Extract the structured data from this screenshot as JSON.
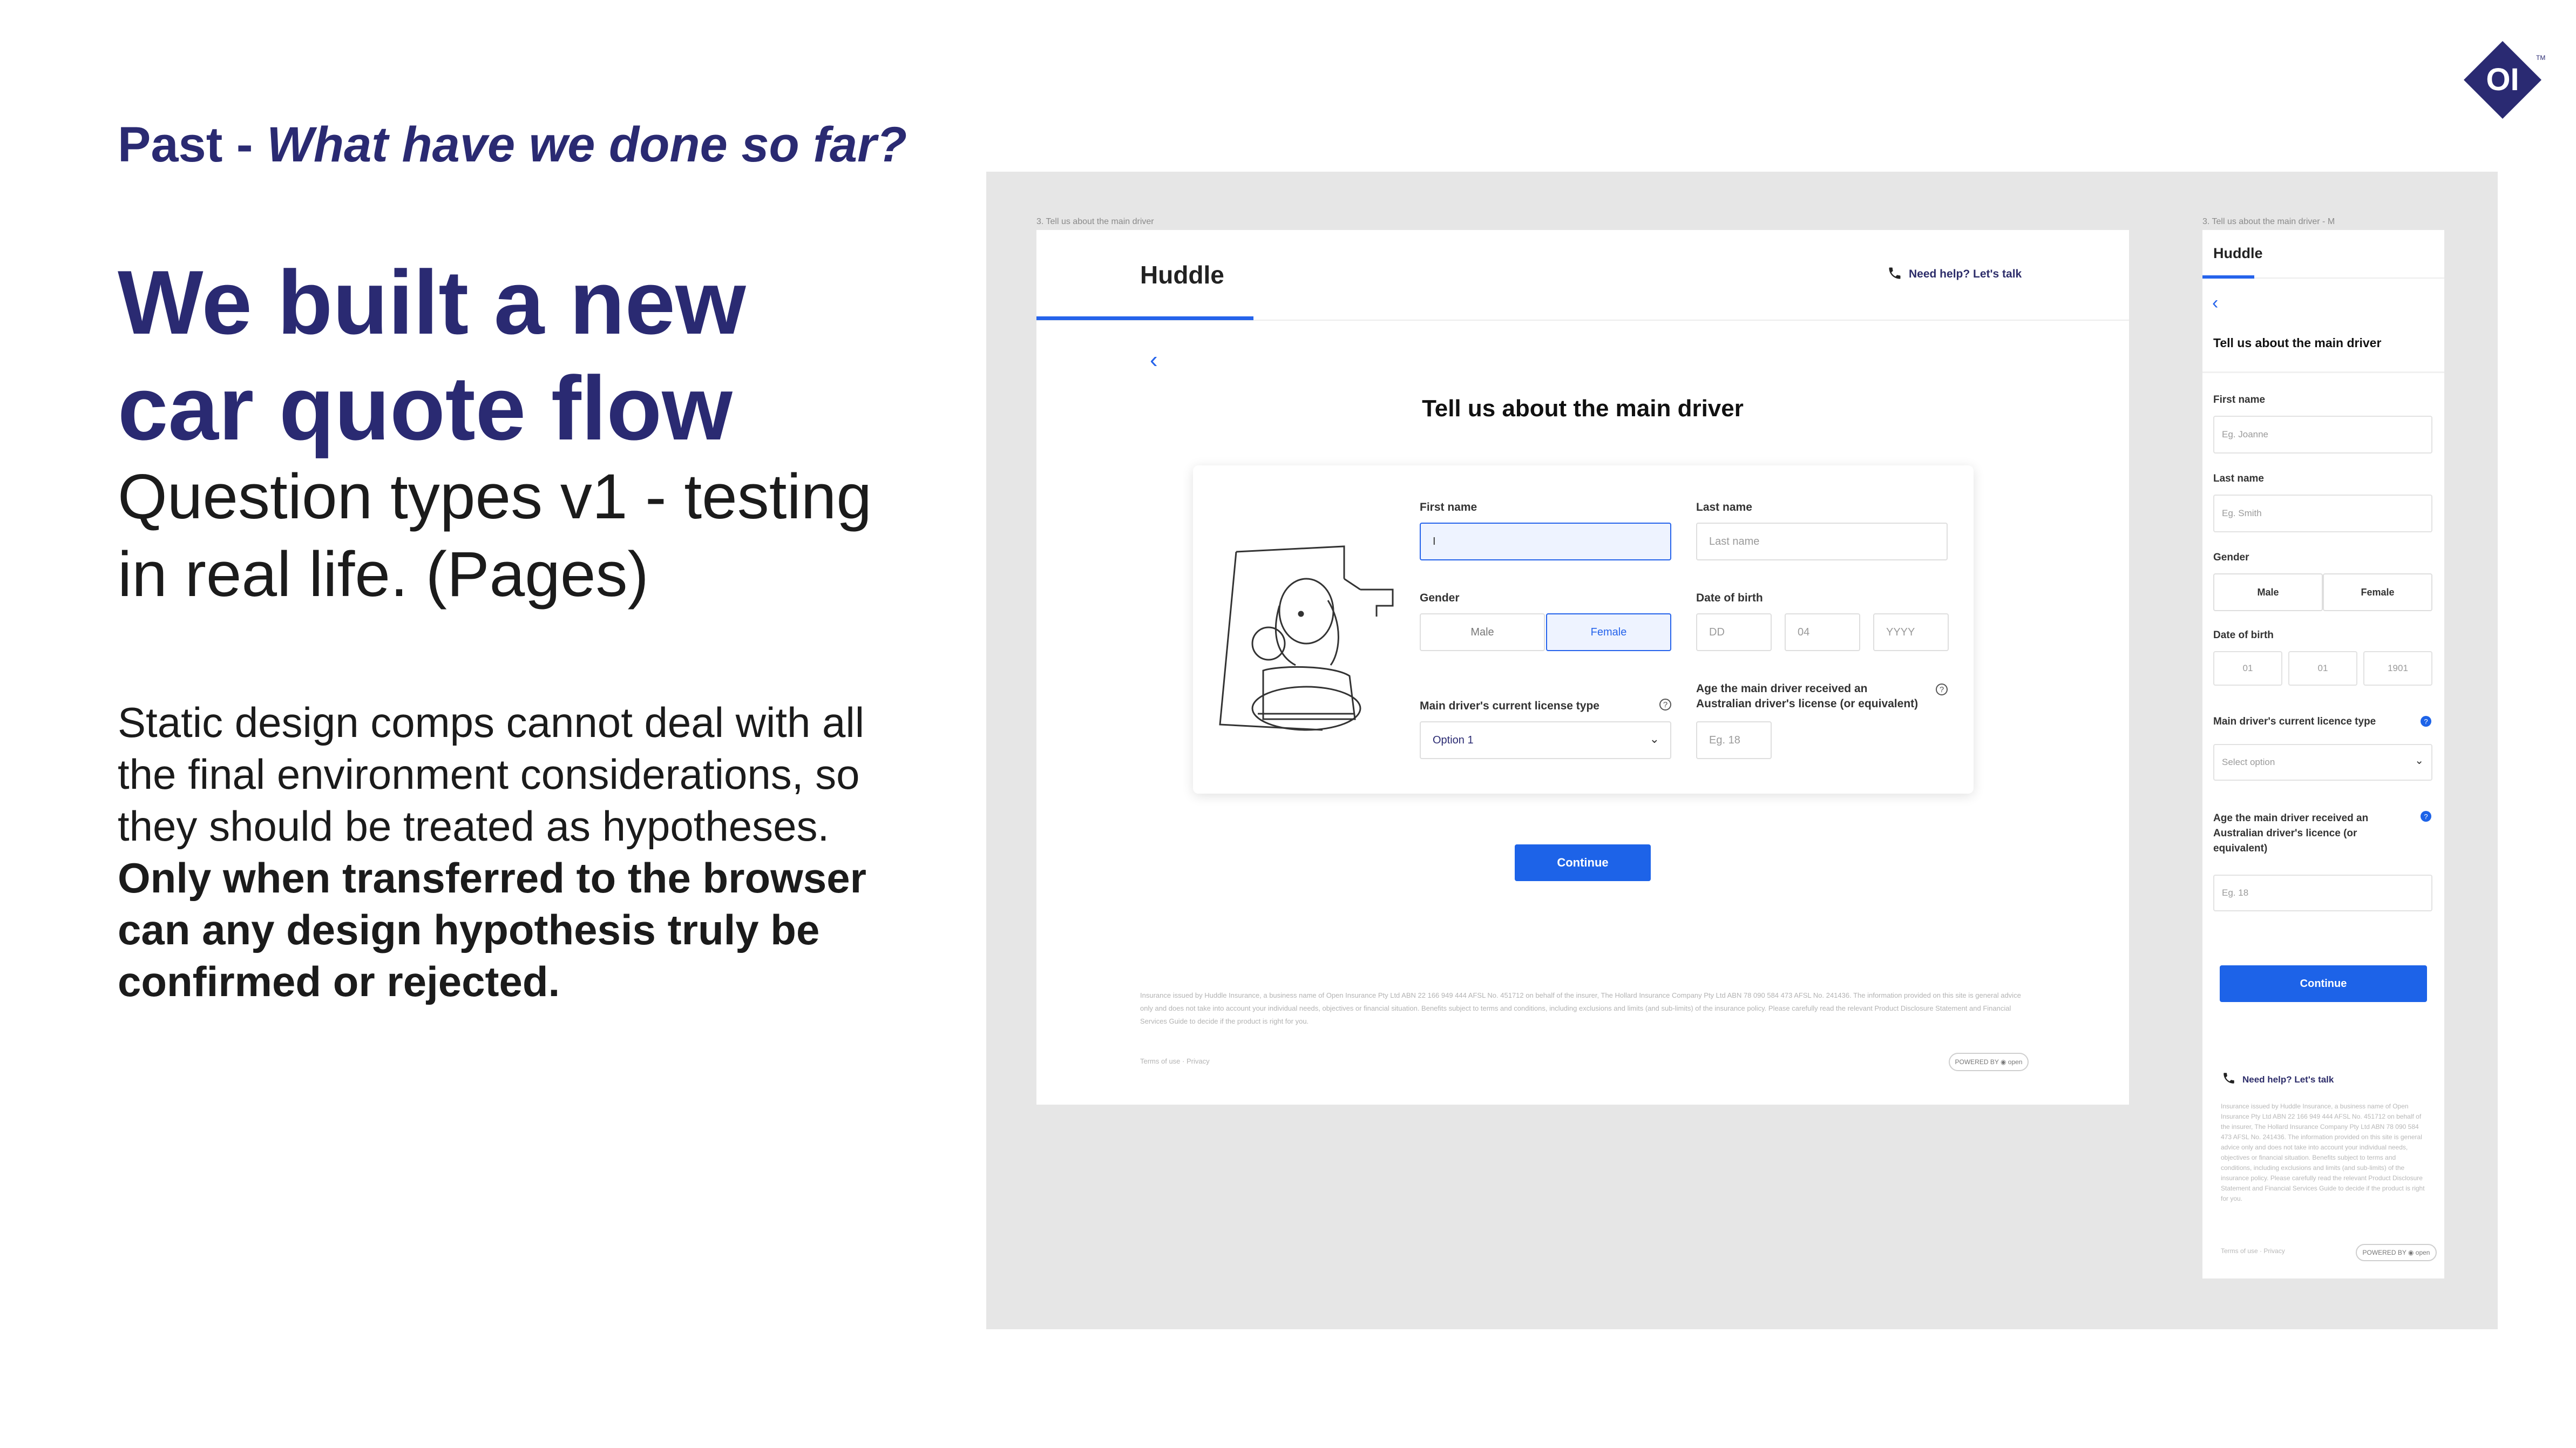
{
  "slide": {
    "kicker_past": "Past - ",
    "kicker_question": "What have we done so far?",
    "headline": "We built a new car quote flow",
    "subline": "Question types v1 - testing in real life. (Pages)",
    "body_plain": "Static design comps cannot deal with all the final environment considerations, so they should be treated as hypotheses.",
    "body_bold": "Only when transferred to the browser can any design hypothesis truly be confirmed or rejected.",
    "logo_text": "OI",
    "logo_tm": "TM"
  },
  "colors": {
    "brand_navy": "#2a2a72",
    "accent_blue": "#1d63e8",
    "canvas_gray": "#e6e6e6"
  },
  "desktop": {
    "frame_label": "3. Tell us about the main driver",
    "brand": "Huddle",
    "help_text": "Need help? Let's talk",
    "title": "Tell us about the main driver",
    "first_name_label": "First name",
    "first_name_value": "I",
    "last_name_label": "Last name",
    "last_name_placeholder": "Last name",
    "gender_label": "Gender",
    "gender_male": "Male",
    "gender_female": "Female",
    "dob_label": "Date of birth",
    "dob_dd": "DD",
    "dob_mm": "04",
    "dob_yyyy": "YYYY",
    "license_type_label": "Main driver's current license type",
    "license_type_value": "Option 1",
    "license_age_label": "Age the main driver received an Australian driver's license (or equivalent)",
    "license_age_placeholder": "Eg. 18",
    "continue": "Continue",
    "disclaimer": "Insurance issued by Huddle Insurance, a business name of Open Insurance Pty Ltd ABN 22 166 949 444 AFSL No. 451712 on behalf of the insurer, The Hollard Insurance Company Pty Ltd ABN 78 090 584 473 AFSL No. 241436. The information provided on this site is general advice only and does not take into account your individual needs, objectives or financial situation. Benefits subject to terms and conditions, including exclusions and limits (and sub-limits) of the insurance policy. Please carefully read the relevant Product Disclosure Statement and Financial Services Guide to decide if the product is right for you.",
    "terms": "Terms of use · Privacy",
    "powered": "POWERED BY ◉ open"
  },
  "mobile": {
    "frame_label": "3. Tell us about the main driver - M",
    "brand": "Huddle",
    "title": "Tell us about the main driver",
    "first_name_label": "First name",
    "first_name_placeholder": "Eg. Joanne",
    "last_name_label": "Last name",
    "last_name_placeholder": "Eg. Smith",
    "gender_label": "Gender",
    "gender_male": "Male",
    "gender_female": "Female",
    "dob_label": "Date of birth",
    "dob_dd": "01",
    "dob_mm": "01",
    "dob_yyyy": "1901",
    "licence_type_label": "Main driver's current licence type",
    "licence_type_value": "Select option",
    "licence_age_label": "Age the main driver received an Australian driver's licence (or equivalent)",
    "licence_age_placeholder": "Eg. 18",
    "continue": "Continue",
    "help_text": "Need help? Let's talk",
    "disclaimer": "Insurance issued by Huddle Insurance, a business name of Open Insurance Pty Ltd ABN 22 166 949 444 AFSL No. 451712 on behalf of the insurer, The Hollard Insurance Company Pty Ltd ABN 78 090 584 473 AFSL No. 241436. The information provided on this site is general advice only and does not take into account your individual needs, objectives or financial situation. Benefits subject to terms and conditions, including exclusions and limits (and sub-limits) of the insurance policy. Please carefully read the relevant Product Disclosure Statement and Financial Services Guide to decide if the product is right for you.",
    "terms": "Terms of use · Privacy",
    "powered": "POWERED BY ◉ open"
  }
}
